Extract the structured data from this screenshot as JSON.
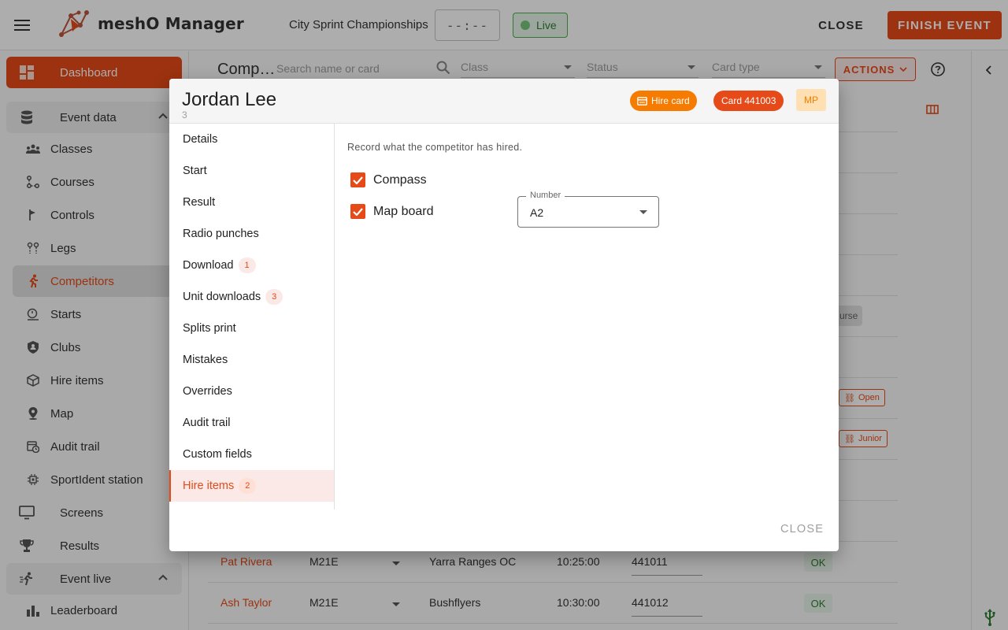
{
  "app": {
    "name": "meshO Manager",
    "event_name": "City Sprint Championships",
    "clock": "--:--",
    "live_label": "Live",
    "close_label": "CLOSE",
    "finish_label": "FINISH EVENT"
  },
  "sidebar": {
    "dashboard": "Dashboard",
    "event_data": "Event data",
    "items": [
      "Classes",
      "Courses",
      "Controls",
      "Legs",
      "Competitors",
      "Starts",
      "Clubs",
      "Hire items",
      "Map",
      "Audit trail",
      "SportIdent station"
    ],
    "active": "Competitors",
    "screens": "Screens",
    "results": "Results",
    "event_live": "Event live",
    "leaderboard": "Leaderboard"
  },
  "background": {
    "title": "Comp…",
    "search_placeholder": "Search name or card",
    "filters": [
      "Class",
      "Status",
      "Card type"
    ],
    "actions_label": "ACTIONS",
    "chips": {
      "course_partial": "urse",
      "open": "Open",
      "junior": "Junior"
    },
    "rows": [
      {
        "name": "Pat Rivera",
        "class": "M21E",
        "club": "Yarra Ranges OC",
        "start": "10:25:00",
        "card": "441011",
        "status": "OK"
      },
      {
        "name": "Ash Taylor",
        "class": "M21E",
        "club": "Bushflyers",
        "start": "10:30:00",
        "card": "441012",
        "status": "OK"
      }
    ]
  },
  "modal": {
    "title": "Jordan Lee",
    "subtitle": "3",
    "chips": {
      "hire_card": "Hire card",
      "card": "Card 441003",
      "mp": "MP"
    },
    "nav": [
      {
        "label": "Details"
      },
      {
        "label": "Start"
      },
      {
        "label": "Result"
      },
      {
        "label": "Radio punches"
      },
      {
        "label": "Download",
        "count": "1"
      },
      {
        "label": "Unit downloads",
        "count": "3"
      },
      {
        "label": "Splits print"
      },
      {
        "label": "Mistakes"
      },
      {
        "label": "Overrides"
      },
      {
        "label": "Audit trail"
      },
      {
        "label": "Custom fields"
      },
      {
        "label": "Hire items",
        "count": "2"
      }
    ],
    "active_nav": "Hire items",
    "description": "Record what the competitor has hired.",
    "hire_items": [
      {
        "label": "Compass",
        "checked": true
      },
      {
        "label": "Map board",
        "checked": true
      }
    ],
    "number_field": {
      "label": "Number",
      "value": "A2"
    },
    "close_label": "CLOSE"
  },
  "colors": {
    "accent": "#e64a19",
    "hire_chip": "#f57c00",
    "live": "#4caf50"
  }
}
